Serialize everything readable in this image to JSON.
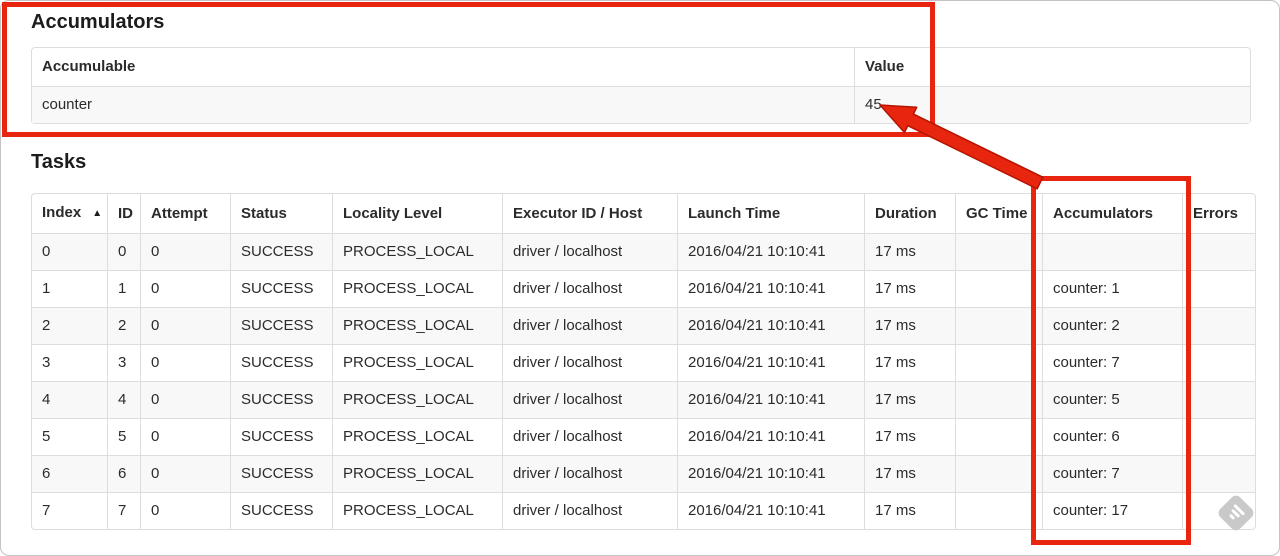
{
  "accumulators_section": {
    "title": "Accumulators",
    "table": {
      "columns": [
        {
          "label": "Accumulable"
        },
        {
          "label": "Value"
        }
      ],
      "rows": [
        [
          "counter",
          "45"
        ]
      ]
    }
  },
  "tasks_section": {
    "title": "Tasks",
    "table": {
      "columns": [
        {
          "label": "Index",
          "sort_icon": "▲"
        },
        {
          "label": "ID"
        },
        {
          "label": "Attempt"
        },
        {
          "label": "Status"
        },
        {
          "label": "Locality Level"
        },
        {
          "label": "Executor ID / Host"
        },
        {
          "label": "Launch Time"
        },
        {
          "label": "Duration"
        },
        {
          "label": "GC Time"
        },
        {
          "label": "Accumulators"
        },
        {
          "label": "Errors"
        }
      ],
      "rows": [
        [
          "0",
          "0",
          "0",
          "SUCCESS",
          "PROCESS_LOCAL",
          "driver / localhost",
          "2016/04/21 10:10:41",
          "17 ms",
          "",
          "",
          ""
        ],
        [
          "1",
          "1",
          "0",
          "SUCCESS",
          "PROCESS_LOCAL",
          "driver / localhost",
          "2016/04/21 10:10:41",
          "17 ms",
          "",
          "counter: 1",
          ""
        ],
        [
          "2",
          "2",
          "0",
          "SUCCESS",
          "PROCESS_LOCAL",
          "driver / localhost",
          "2016/04/21 10:10:41",
          "17 ms",
          "",
          "counter: 2",
          ""
        ],
        [
          "3",
          "3",
          "0",
          "SUCCESS",
          "PROCESS_LOCAL",
          "driver / localhost",
          "2016/04/21 10:10:41",
          "17 ms",
          "",
          "counter: 7",
          ""
        ],
        [
          "4",
          "4",
          "0",
          "SUCCESS",
          "PROCESS_LOCAL",
          "driver / localhost",
          "2016/04/21 10:10:41",
          "17 ms",
          "",
          "counter: 5",
          ""
        ],
        [
          "5",
          "5",
          "0",
          "SUCCESS",
          "PROCESS_LOCAL",
          "driver / localhost",
          "2016/04/21 10:10:41",
          "17 ms",
          "",
          "counter: 6",
          ""
        ],
        [
          "6",
          "6",
          "0",
          "SUCCESS",
          "PROCESS_LOCAL",
          "driver / localhost",
          "2016/04/21 10:10:41",
          "17 ms",
          "",
          "counter: 7",
          ""
        ],
        [
          "7",
          "7",
          "0",
          "SUCCESS",
          "PROCESS_LOCAL",
          "driver / localhost",
          "2016/04/21 10:10:41",
          "17 ms",
          "",
          "counter: 17",
          ""
        ]
      ]
    }
  },
  "annotations": {
    "color": "#e8250f",
    "stroke": "#b51400",
    "summary_box_target": "Accumulators summary table",
    "column_box_target": "Accumulators task column",
    "arrow_target": "Value 45"
  }
}
